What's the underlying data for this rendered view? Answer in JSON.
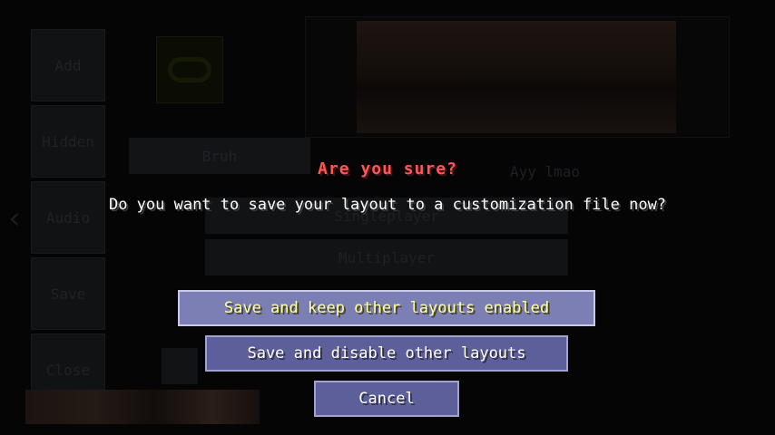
{
  "background": {
    "sidebar_buttons": [
      "Add",
      "Hidden",
      "Audio",
      "Save",
      "Close"
    ],
    "back_arrow": "‹",
    "bruh_button": "Bruh",
    "ayy_label": "Ayy lmao",
    "menu_buttons": [
      "Singleplayer",
      "Multiplayer"
    ]
  },
  "dialog": {
    "title": "Are you sure?",
    "message": "Do you want to save your layout to a customization file now?",
    "buttons": {
      "save_keep": "Save and keep other layouts enabled",
      "save_disable": "Save and disable other layouts",
      "cancel": "Cancel"
    }
  },
  "colors": {
    "title": "#ff5555",
    "highlight_text": "#ffffa0",
    "button_fill": "#5c5f99"
  }
}
